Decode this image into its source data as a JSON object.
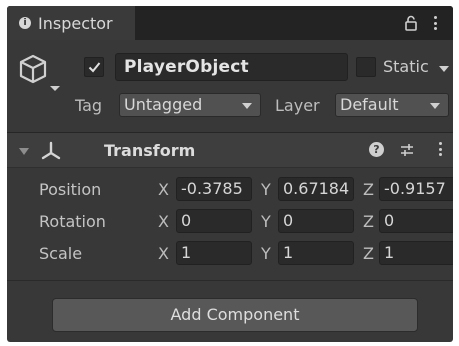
{
  "tab": {
    "title": "Inspector"
  },
  "object": {
    "active": true,
    "name": "PlayerObject",
    "static_label": "Static",
    "tag_label": "Tag",
    "tag_value": "Untagged",
    "layer_label": "Layer",
    "layer_value": "Default"
  },
  "transform": {
    "title": "Transform",
    "rows": [
      {
        "label": "Position",
        "x": "-0.3785",
        "y": "0.67184",
        "z": "-0.9157"
      },
      {
        "label": "Rotation",
        "x": "0",
        "y": "0",
        "z": "0"
      },
      {
        "label": "Scale",
        "x": "1",
        "y": "1",
        "z": "1"
      }
    ],
    "axes": {
      "x": "X",
      "y": "Y",
      "z": "Z"
    }
  },
  "add_component_label": "Add Component",
  "icons": [
    "info-icon",
    "lock-icon",
    "menu-icon",
    "gameobject-cube-icon",
    "checkmark-icon",
    "transform-axes-icon",
    "help-icon",
    "presets-icon"
  ],
  "colors": {
    "panel": "#383838",
    "tabbar": "#232323",
    "field": "#2a2a2a",
    "button": "#585858"
  }
}
